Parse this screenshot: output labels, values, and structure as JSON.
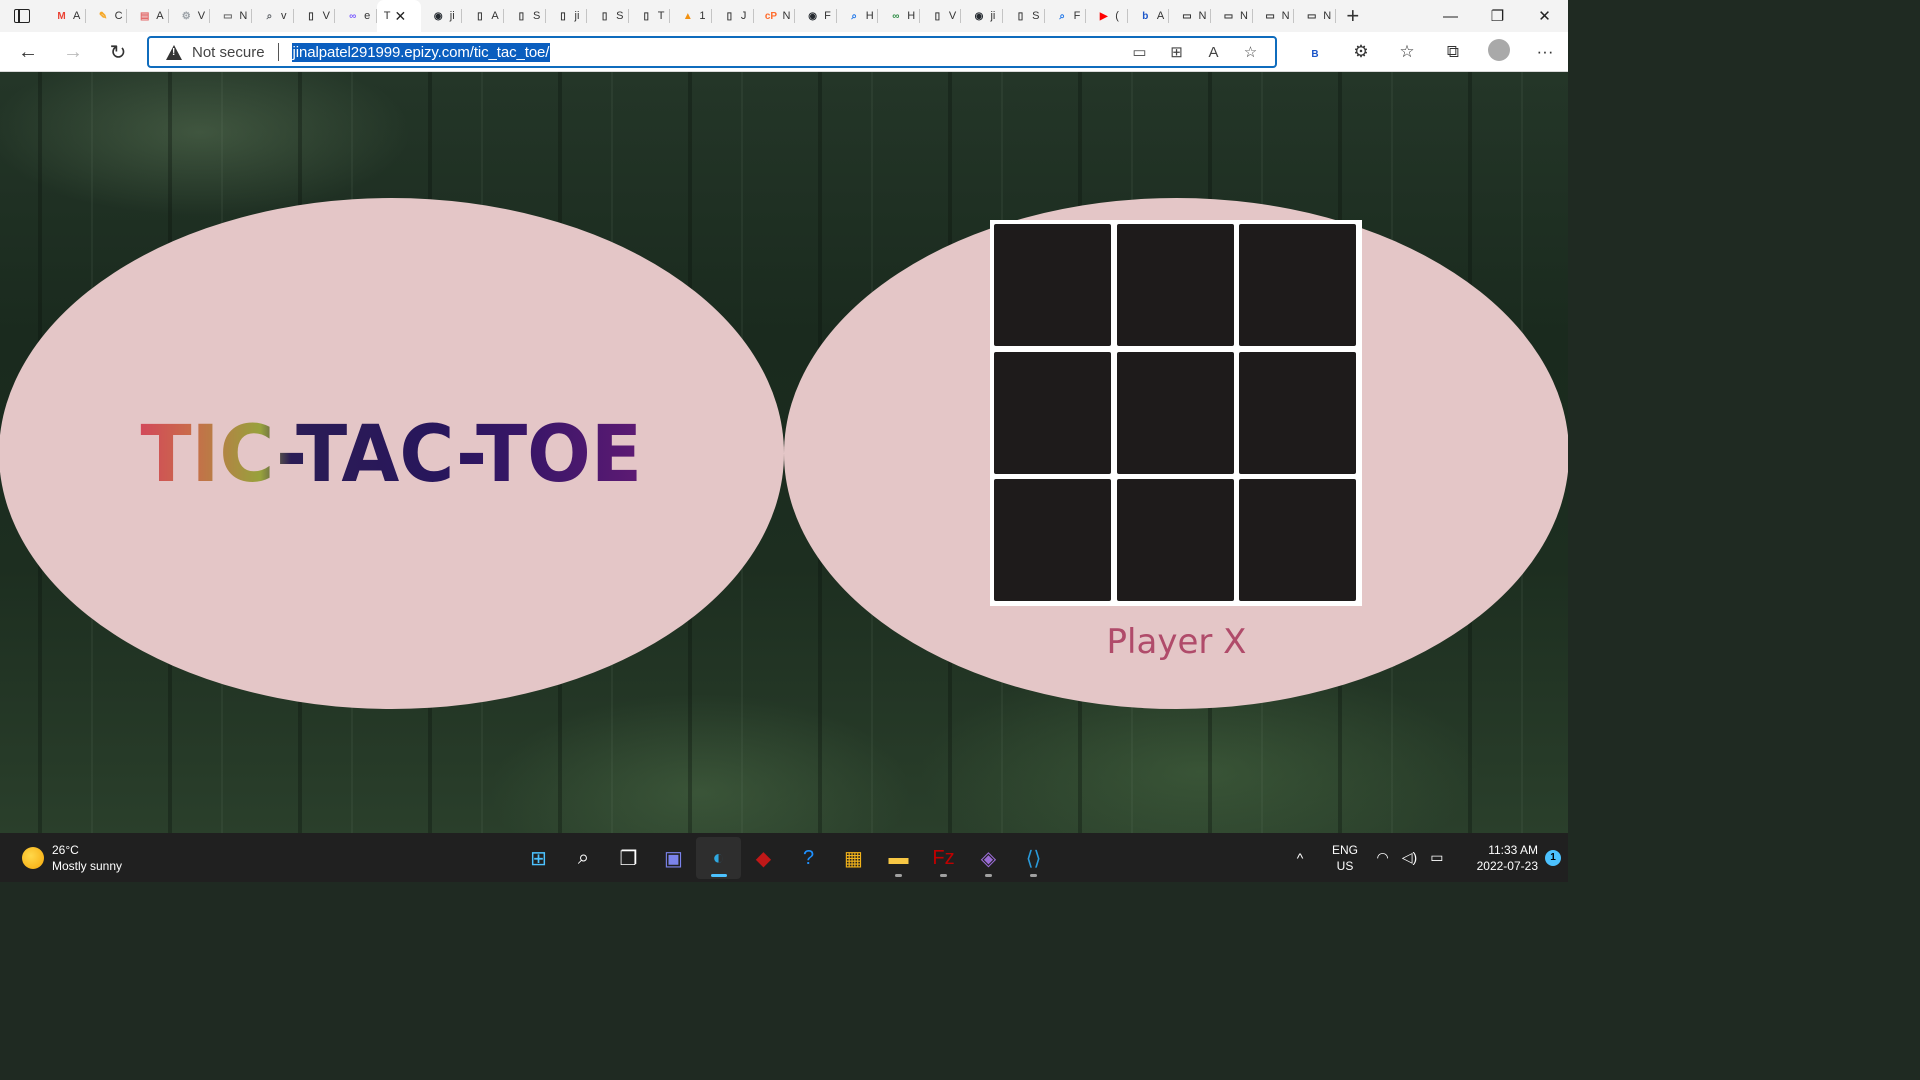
{
  "browser": {
    "tabs": [
      {
        "icon": "gmail-icon",
        "label": "A",
        "color": "#ea4335",
        "glyph": "M"
      },
      {
        "icon": "pencil-icon",
        "label": "C",
        "color": "#f5a623",
        "glyph": "✎"
      },
      {
        "icon": "pdf-icon",
        "label": "A",
        "color": "#e36b6b",
        "glyph": "▤"
      },
      {
        "icon": "gear-icon",
        "label": "V",
        "color": "#9aa0a6",
        "glyph": "⚙"
      },
      {
        "icon": "window-icon",
        "label": "N",
        "color": "#666666",
        "glyph": "▭"
      },
      {
        "icon": "search-icon",
        "label": "v",
        "color": "#5f6368",
        "glyph": "⌕"
      },
      {
        "icon": "page-icon",
        "label": "V",
        "color": "#333333",
        "glyph": "▯"
      },
      {
        "icon": "infinity-icon",
        "label": "e",
        "color": "#7a5cff",
        "glyph": "∞"
      }
    ],
    "active_tab": {
      "label": "T",
      "close": "✕"
    },
    "tabs_after": [
      {
        "icon": "github-icon",
        "label": "ji",
        "color": "#24292f",
        "glyph": "◉"
      },
      {
        "icon": "page-icon",
        "label": "A",
        "color": "#333333",
        "glyph": "▯"
      },
      {
        "icon": "page-icon",
        "label": "S",
        "color": "#333333",
        "glyph": "▯"
      },
      {
        "icon": "page-icon",
        "label": "ji",
        "color": "#333333",
        "glyph": "▯"
      },
      {
        "icon": "page-icon",
        "label": "S",
        "color": "#333333",
        "glyph": "▯"
      },
      {
        "icon": "page-icon",
        "label": "T",
        "color": "#333333",
        "glyph": "▯"
      },
      {
        "icon": "phpmyadmin-icon",
        "label": "1",
        "color": "#f29111",
        "glyph": "▲"
      },
      {
        "icon": "page-icon",
        "label": "J",
        "color": "#333333",
        "glyph": "▯"
      },
      {
        "icon": "cpanel-icon",
        "label": "N",
        "color": "#ff6c2c",
        "glyph": "cP"
      },
      {
        "icon": "github-icon",
        "label": "F",
        "color": "#24292f",
        "glyph": "◉"
      },
      {
        "icon": "search-icon",
        "label": "H",
        "color": "#1a73e8",
        "glyph": "⌕"
      },
      {
        "icon": "geeks-icon",
        "label": "H",
        "color": "#2f8d46",
        "glyph": "∞"
      },
      {
        "icon": "page-icon",
        "label": "V",
        "color": "#333333",
        "glyph": "▯"
      },
      {
        "icon": "github-icon",
        "label": "ji",
        "color": "#24292f",
        "glyph": "◉"
      },
      {
        "icon": "page-icon",
        "label": "S",
        "color": "#333333",
        "glyph": "▯"
      },
      {
        "icon": "search-icon",
        "label": "F",
        "color": "#1a73e8",
        "glyph": "⌕"
      },
      {
        "icon": "youtube-icon",
        "label": "(",
        "color": "#ff0000",
        "glyph": "▶"
      },
      {
        "icon": "bing-icon",
        "label": "A",
        "color": "#1a55c9",
        "glyph": "b"
      },
      {
        "icon": "window-icon",
        "label": "N",
        "color": "#333333",
        "glyph": "▭"
      },
      {
        "icon": "window-icon",
        "label": "N",
        "color": "#333333",
        "glyph": "▭"
      },
      {
        "icon": "window-icon",
        "label": "N",
        "color": "#333333",
        "glyph": "▭"
      },
      {
        "icon": "window-icon",
        "label": "N",
        "color": "#333333",
        "glyph": "▭"
      }
    ],
    "new_tab": "+",
    "window_controls": {
      "minimize": "—",
      "restore": "❐",
      "close": "✕"
    },
    "address": {
      "security_label": "Not secure",
      "url": "jinalpatel291999.epizy.com/tic_tac_toe/"
    },
    "addr_icons": [
      "▭",
      "⊞",
      "A",
      "☆"
    ],
    "right_tools": {
      "bing": "B",
      "extensions": "⚙",
      "favorites": "☆",
      "collections": "⧉",
      "more": "···"
    }
  },
  "page": {
    "title": "TIC-TAC-TOE",
    "board": [
      "",
      "",
      "",
      "",
      "",
      "",
      "",
      "",
      ""
    ],
    "player": "Player X"
  },
  "taskbar": {
    "weather": {
      "temp": "26°C",
      "condition": "Mostly sunny"
    },
    "apps": [
      {
        "name": "start-icon",
        "glyph": "⊞",
        "color": "#4cc2ff",
        "dot": false
      },
      {
        "name": "search-icon",
        "glyph": "⌕",
        "color": "#ffffff",
        "dot": false
      },
      {
        "name": "task-view-icon",
        "glyph": "❐",
        "color": "#ffffff",
        "dot": false
      },
      {
        "name": "teams-chat-icon",
        "glyph": "▣",
        "color": "#7b83eb",
        "dot": false
      },
      {
        "name": "edge-icon",
        "glyph": "◐",
        "color": "#2fa8e0",
        "dot": true,
        "active": true
      },
      {
        "name": "mcafee-icon",
        "glyph": "◆",
        "color": "#c01818",
        "dot": false
      },
      {
        "name": "help-icon",
        "glyph": "?",
        "color": "#1e90ff",
        "dot": false
      },
      {
        "name": "store-icon",
        "glyph": "▦",
        "color": "#f3b31a",
        "dot": false
      },
      {
        "name": "file-explorer-icon",
        "glyph": "▬",
        "color": "#f7c744",
        "dot": true
      },
      {
        "name": "filezilla-icon",
        "glyph": "Fz",
        "color": "#bf0000",
        "dot": true
      },
      {
        "name": "visual-studio-icon",
        "glyph": "◈",
        "color": "#9b6cd6",
        "dot": true
      },
      {
        "name": "vscode-icon",
        "glyph": "⟨⟩",
        "color": "#2a9bdc",
        "dot": true
      }
    ],
    "tray_chevron": "^",
    "lang": {
      "line1": "ENG",
      "line2": "US"
    },
    "time": "11:33 AM",
    "date": "2022-07-23",
    "notifications": "1"
  }
}
